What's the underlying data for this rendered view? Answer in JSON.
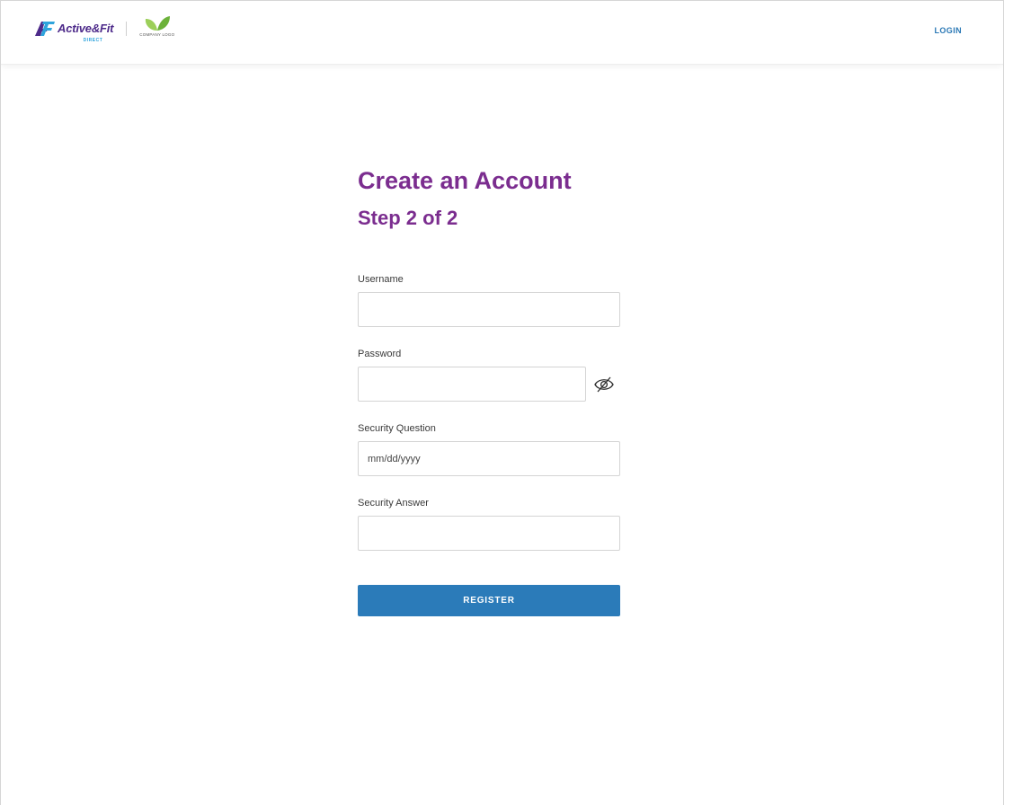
{
  "header": {
    "brand_name": "Active&Fit",
    "brand_sub": "DIRECT",
    "company_logo_text": "COMPANY LOGO",
    "login_label": "LOGIN"
  },
  "form": {
    "title": "Create an Account",
    "step": "Step 2 of 2",
    "fields": {
      "username": {
        "label": "Username",
        "value": "",
        "placeholder": ""
      },
      "password": {
        "label": "Password",
        "value": "",
        "placeholder": ""
      },
      "security_question": {
        "label": "Security Question",
        "value": "",
        "placeholder": "mm/dd/yyyy"
      },
      "security_answer": {
        "label": "Security Answer",
        "value": "",
        "placeholder": ""
      }
    },
    "register_label": "REGISTER"
  },
  "icons": {
    "brand_mark": "af-logo-icon",
    "company_leaf": "leaf-icon",
    "password_toggle": "eye-slash-icon"
  },
  "colors": {
    "brand_purple": "#7b2d8f",
    "accent_blue": "#2b7bb9",
    "link_blue": "#2a78b5",
    "logo_purple": "#4d2a8a",
    "logo_cyan": "#2fa4dc",
    "leaf_green": "#7fc241"
  }
}
